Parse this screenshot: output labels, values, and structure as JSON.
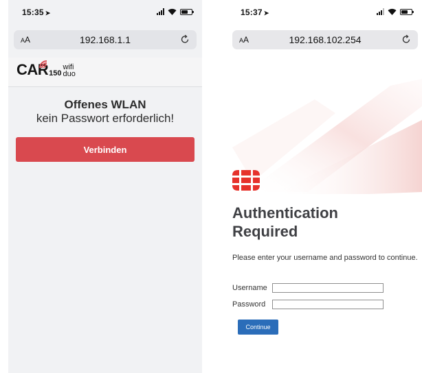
{
  "left": {
    "status_time": "15:35",
    "url": "192.168.1.1",
    "aa_label": "AA",
    "logo": {
      "brand": "CAR",
      "number": "150",
      "wifi": "wifi",
      "duo": "duo"
    },
    "headline": "Offenes WLAN",
    "subline": "kein Passwort erforderlich!",
    "connect_label": "Verbinden",
    "colors": {
      "button": "#d9494f",
      "page_bg": "#f1f2f4"
    }
  },
  "right": {
    "status_time": "15:37",
    "url": "192.168.102.254",
    "aa_label": "AA",
    "title_line1": "Authentication",
    "title_line2": "Required",
    "description": "Please enter your username and password to continue.",
    "username_label": "Username",
    "password_label": "Password",
    "username_value": "",
    "password_value": "",
    "continue_label": "Continue",
    "colors": {
      "logo": "#e6322c",
      "button": "#2b6db9"
    }
  }
}
